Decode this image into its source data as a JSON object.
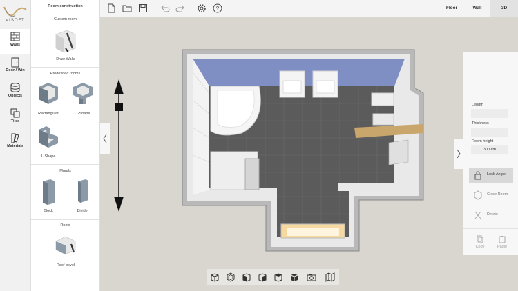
{
  "app": {
    "logo_text": "VISOFT"
  },
  "rail": {
    "items": [
      {
        "label": "Walls",
        "icon": "walls-icon",
        "active": true
      },
      {
        "label": "Door / Win",
        "icon": "door-window-icon"
      },
      {
        "label": "Objects",
        "icon": "objects-icon"
      },
      {
        "label": "Tiles",
        "icon": "tiles-icon"
      },
      {
        "label": "Materials",
        "icon": "materials-icon"
      }
    ]
  },
  "panel": {
    "title": "Room construction",
    "custom_section": "Custom room",
    "draw_walls": "Draw Walls",
    "predefined_section": "Predefined rooms",
    "rectangular": "Rectangular",
    "tshape": "T-Shape",
    "lshape": "L-Shape",
    "murals_section": "Murals",
    "block": "Block",
    "divider": "Divider",
    "roofs_section": "Roofs",
    "roof_bevel": "Roof bevel"
  },
  "toolbar": {
    "icons": [
      "new-file-icon",
      "open-folder-icon",
      "save-icon",
      "undo-icon",
      "redo-icon",
      "settings-icon",
      "help-icon"
    ]
  },
  "view_tabs": {
    "floor": "Floor",
    "wall": "Wall",
    "threed": "3D",
    "active": "3D"
  },
  "properties": {
    "length_label": "Length",
    "length_value": "",
    "thickness_label": "Thickness",
    "thickness_value": "",
    "height_label": "Room height",
    "height_value": "300 cm",
    "lock_angle": "Lock Angle",
    "close_room": "Close Room",
    "delete": "Delete",
    "copy": "Copy",
    "paste": "Paste"
  },
  "bottom_toolbar": {
    "icons": [
      "view-front-icon",
      "view-top-icon",
      "view-left-icon",
      "view-right-icon",
      "view-back-icon",
      "view-iso-icon",
      "camera-icon",
      "map-icon"
    ]
  },
  "colors": {
    "accent": "#c9a66b",
    "ceiling_blue": "#7f8fc4",
    "floor_tile": "#5b5b5b"
  }
}
